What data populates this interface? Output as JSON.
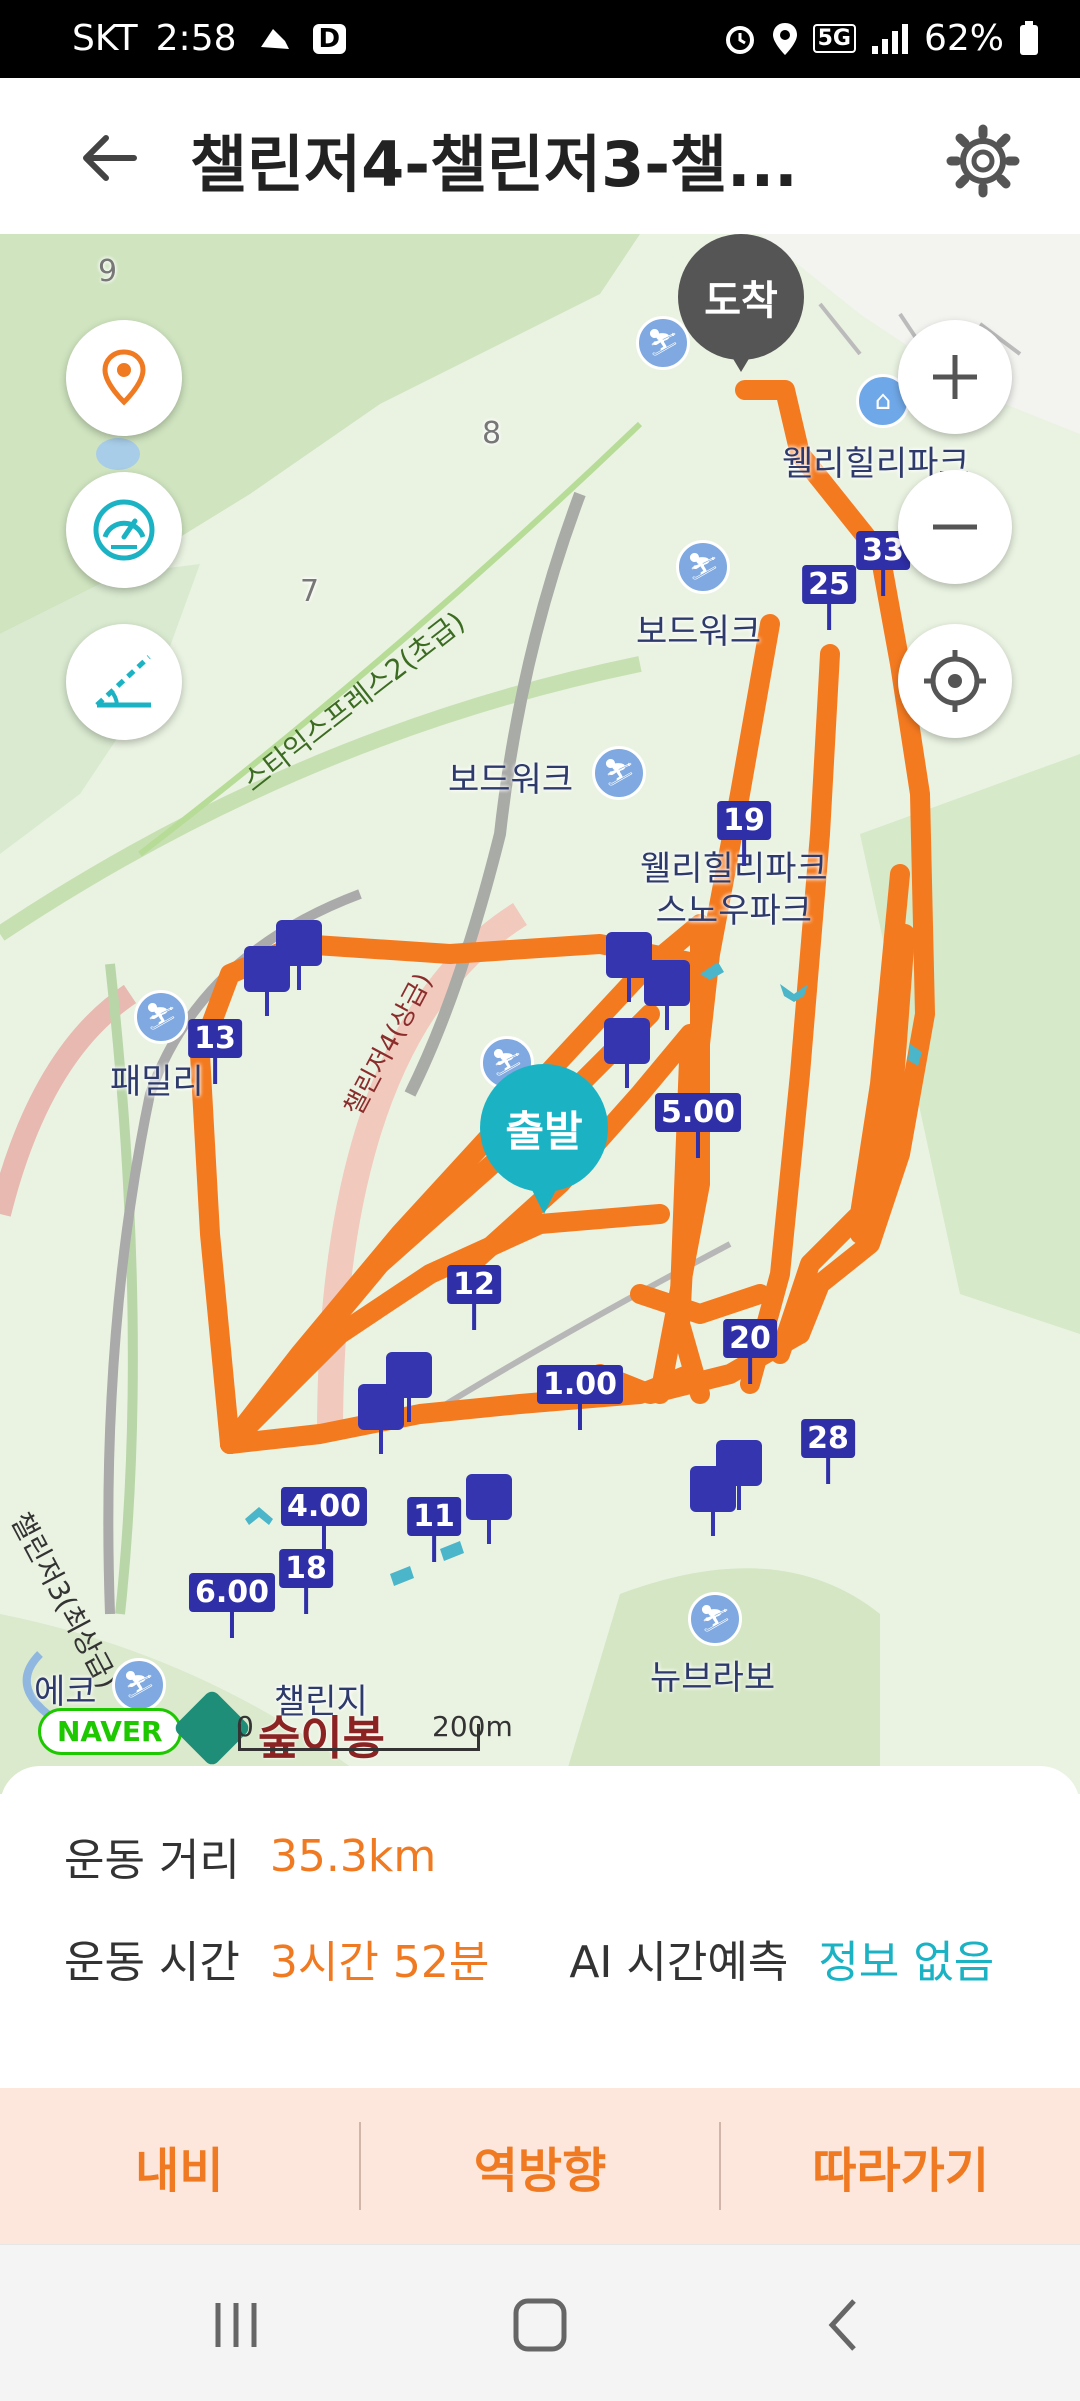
{
  "status_bar": {
    "carrier": "SKT",
    "time": "2:58",
    "app_badge": "D",
    "network": "5G",
    "battery": "62%"
  },
  "header": {
    "title": "챌린저4-챌린저3-챌..."
  },
  "map": {
    "labels": {
      "wellihilli_park": "웰리힐리파크",
      "boardwalk_top": "보드워크",
      "boardwalk_mid": "보드워크",
      "snowpark": "웰리힐리파크\n스노우파크",
      "family": "패밀리",
      "newbrabo": "뉴브라보",
      "eco": "에코",
      "challenger": "챌린지",
      "num_9": "9",
      "num_8": "8",
      "num_7": "7"
    },
    "trail_labels": {
      "styx": "스타익스프레스2(초급)",
      "challenger4": "챌린저4(상급)",
      "challenger3": "챌린저3(최상급)"
    },
    "pins": {
      "end": "도착",
      "start": "출발"
    },
    "markers": [
      "33",
      "25",
      "19",
      "13",
      "5.00",
      "12",
      "20",
      "1.00",
      "28",
      "4.00",
      "11",
      "18",
      "6.00"
    ],
    "logo_naver": "NAVER",
    "logo_brand": "숲이봉",
    "scale_zero": "0",
    "scale": "200m"
  },
  "info": {
    "distance_label": "운동 거리",
    "distance_value": "35.3km",
    "time_label": "운동 시간",
    "time_value": "3시간 52분",
    "ai_label": "AI 시간예측",
    "ai_value": "정보 없음"
  },
  "actions": {
    "navi": "내비",
    "reverse": "역방향",
    "follow": "따라가기"
  },
  "colors": {
    "route": "#f47a20",
    "accent_teal": "#1bb3c4",
    "marker": "#2f2fa8"
  }
}
